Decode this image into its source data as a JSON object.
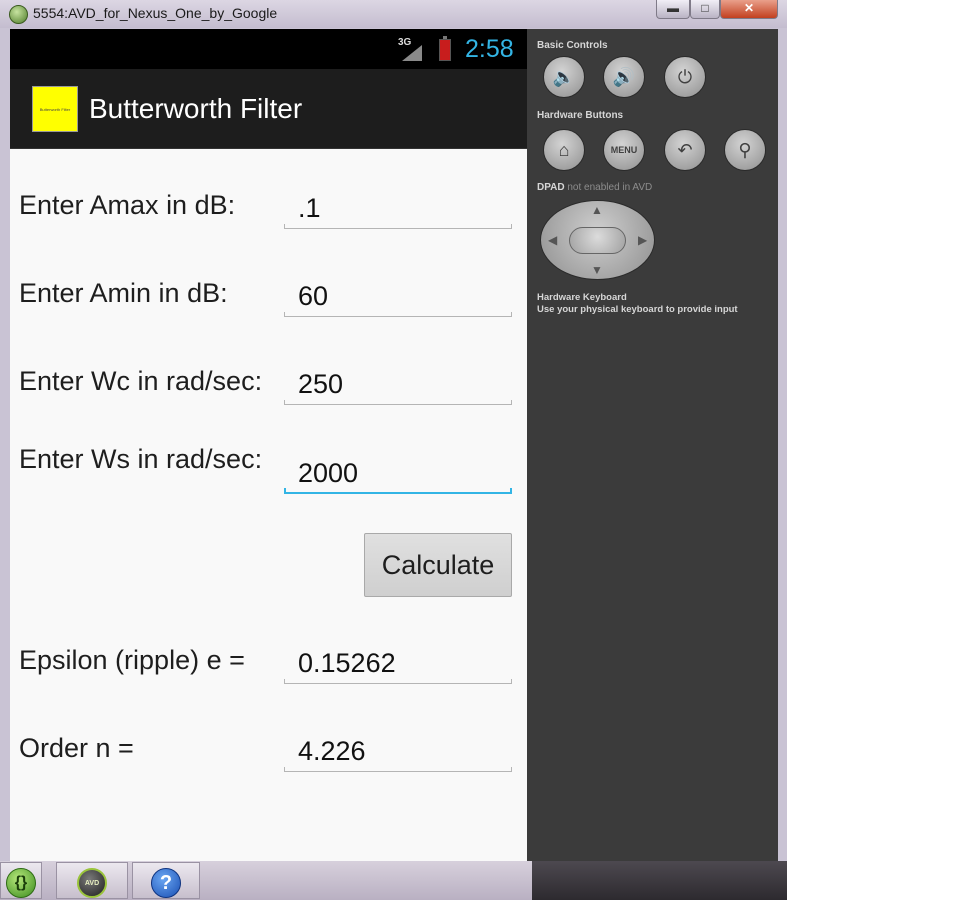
{
  "window": {
    "title": "5554:AVD_for_Nexus_One_by_Google",
    "minimize_icon": "minimize-icon",
    "maximize_icon": "maximize-icon",
    "close_icon": "close-icon",
    "minimize_symbol": "▬",
    "maximize_symbol": "□",
    "close_symbol": "✕"
  },
  "statusbar": {
    "network": "3G",
    "time": "2:58"
  },
  "app": {
    "title": "Butterworth Filter",
    "logo_text": "Butterworth Filter"
  },
  "form": {
    "amax_label": "Enter Amax in dB:",
    "amax_value": ".1",
    "amin_label": "Enter Amin in dB:",
    "amin_value": "60",
    "wc_label": "Enter Wc in rad/sec:",
    "wc_value": "250",
    "ws_label": "Enter Ws in rad/sec:",
    "ws_value": "2000",
    "calculate_label": "Calculate",
    "epsilon_label": "Epsilon (ripple) e =",
    "epsilon_value": "0.15262",
    "order_label": "Order n =",
    "order_value": "4.226"
  },
  "controls": {
    "basic_title": "Basic Controls",
    "hardware_title": "Hardware Buttons",
    "menu_label": "MENU",
    "dpad_title": "DPAD",
    "dpad_note": "not enabled in AVD",
    "keyboard_title": "Hardware Keyboard",
    "keyboard_note": "Use your physical keyboard to provide input"
  },
  "taskbar": {
    "items": [
      "braces-app-icon",
      "avd-manager-icon",
      "help-icon"
    ]
  },
  "colors": {
    "accent": "#33b5e5",
    "actionbar": "#1d1d1d",
    "panel": "#3b3b3b",
    "logo": "#ffff00"
  }
}
